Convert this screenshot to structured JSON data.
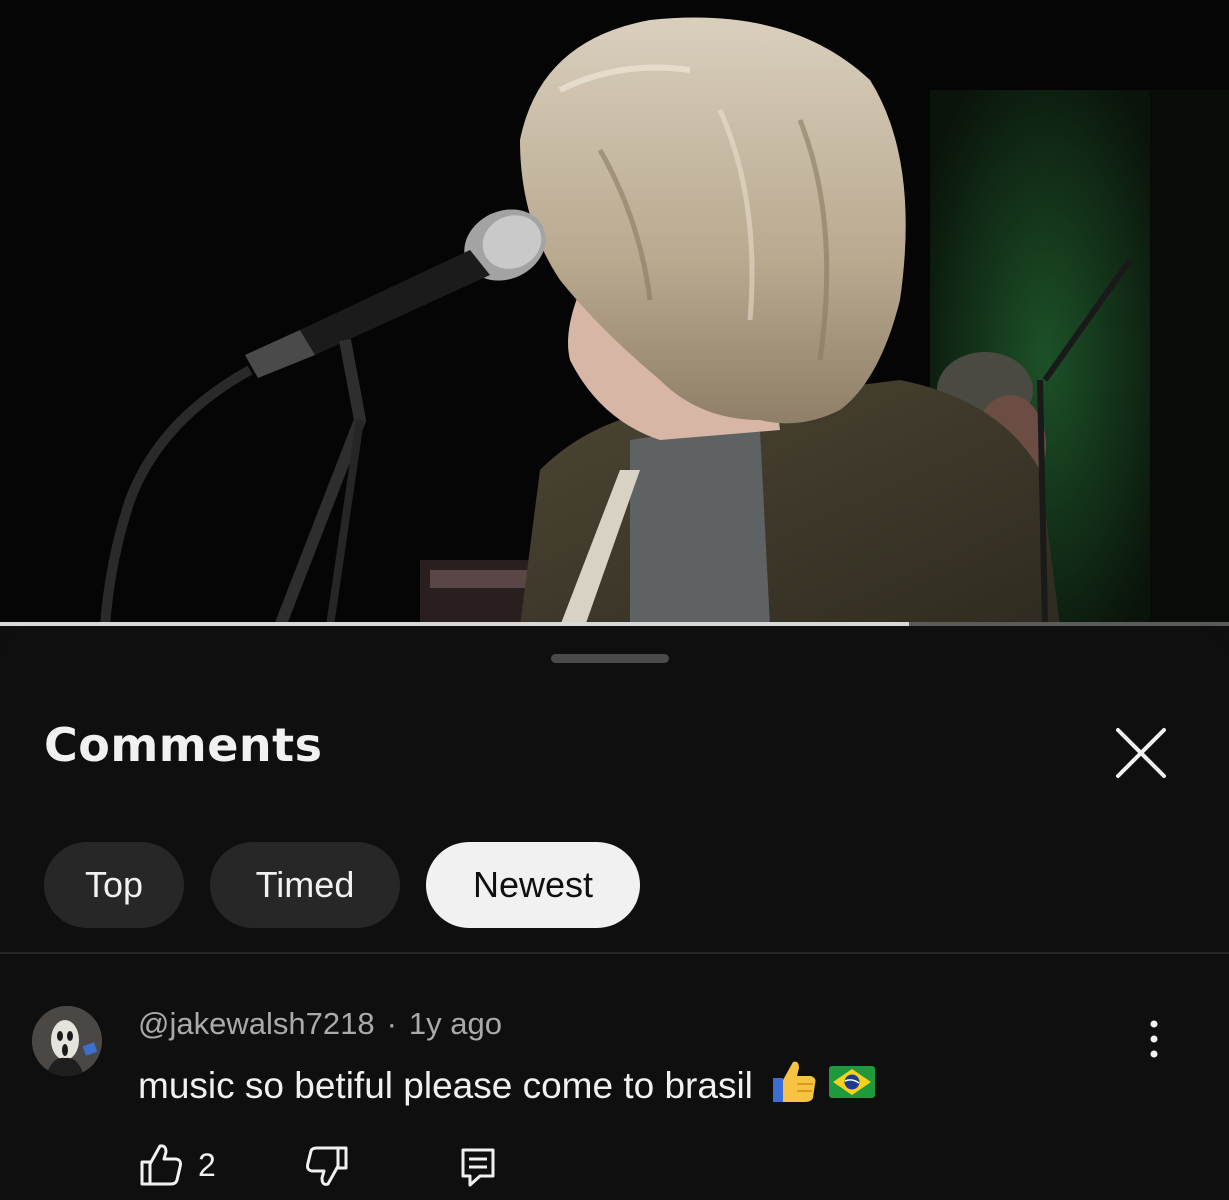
{
  "video": {
    "progress_fraction": 0.74
  },
  "sheet": {
    "title": "Comments"
  },
  "sort_chips": [
    {
      "label": "Top",
      "selected": false
    },
    {
      "label": "Timed",
      "selected": false
    },
    {
      "label": "Newest",
      "selected": true
    }
  ],
  "comment": {
    "author": "@jakewalsh7218",
    "separator": "·",
    "time": "1y ago",
    "text": "music so betiful please come to brasil",
    "emojis": [
      "thumbs-up-emoji",
      "brazil-flag-emoji"
    ],
    "like_count": "2"
  },
  "icons": {
    "close": "close-icon",
    "more": "more-vertical-icon",
    "like": "thumbs-up-icon",
    "dislike": "thumbs-down-icon",
    "reply": "reply-icon"
  },
  "colors": {
    "background": "#0f0f0f",
    "chip": "#272727",
    "chip_selected": "#f1f1f1",
    "text_primary": "#f1f1f1",
    "text_secondary": "#aaaaaa"
  }
}
